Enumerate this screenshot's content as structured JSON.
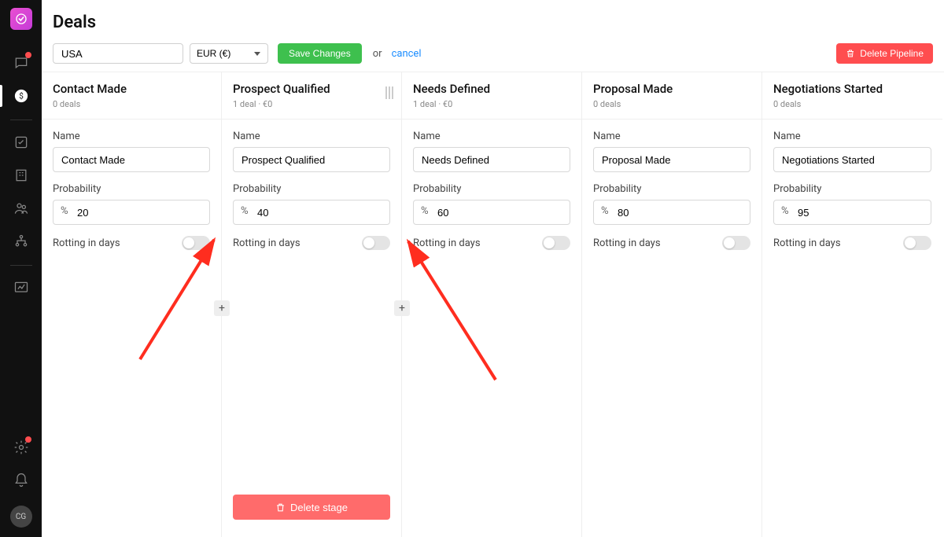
{
  "page": {
    "title": "Deals"
  },
  "toolbar": {
    "pipeline_name": "USA",
    "currency": "EUR (€)",
    "save_label": "Save Changes",
    "or_label": "or",
    "cancel_label": "cancel",
    "delete_pipeline_label": "Delete Pipeline"
  },
  "labels": {
    "name": "Name",
    "probability": "Probability",
    "rotting": "Rotting in days",
    "percent": "%",
    "delete_stage": "Delete stage"
  },
  "columns": [
    {
      "title": "Contact Made",
      "sub": "0 deals",
      "name": "Contact Made",
      "prob": "20",
      "active": false
    },
    {
      "title": "Prospect Qualified",
      "sub": "1 deal · €0",
      "name": "Prospect Qualified",
      "prob": "40",
      "active": true
    },
    {
      "title": "Needs Defined",
      "sub": "1 deal · €0",
      "name": "Needs Defined",
      "prob": "60",
      "active": false
    },
    {
      "title": "Proposal Made",
      "sub": "0 deals",
      "name": "Proposal Made",
      "prob": "80",
      "active": false
    },
    {
      "title": "Negotiations Started",
      "sub": "0 deals",
      "name": "Negotiations Started",
      "prob": "95",
      "active": false
    }
  ],
  "avatar": "CG"
}
